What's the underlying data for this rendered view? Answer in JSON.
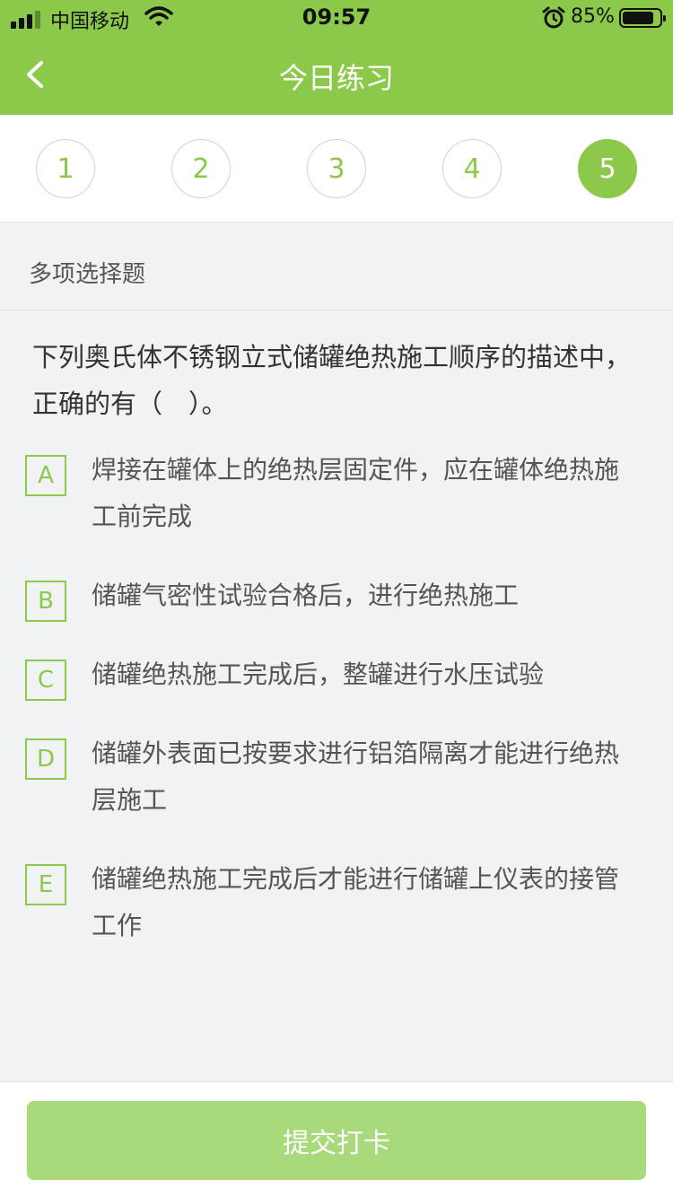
{
  "status_bar": {
    "carrier": "中国移动",
    "time": "09:57",
    "battery_pct": "85%",
    "battery_level": 0.85,
    "icons": [
      "signal-icon",
      "wifi-icon",
      "alarm-icon",
      "battery-icon"
    ]
  },
  "nav": {
    "title": "今日练习",
    "back_icon": "chevron-left-icon"
  },
  "tabs": {
    "items": [
      "1",
      "2",
      "3",
      "4",
      "5"
    ],
    "active_index": 4
  },
  "question": {
    "type": "多项选择题",
    "stem": "下列奥氏体不锈钢立式储罐绝热施工顺序的描述中，正确的有（　）。",
    "options": [
      {
        "letter": "A",
        "text": "焊接在罐体上的绝热层固定件，应在罐体绝热施工前完成"
      },
      {
        "letter": "B",
        "text": "储罐气密性试验合格后，进行绝热施工"
      },
      {
        "letter": "C",
        "text": "储罐绝热施工完成后，整罐进行水压试验"
      },
      {
        "letter": "D",
        "text": "储罐外表面已按要求进行铝箔隔离才能进行绝热层施工"
      },
      {
        "letter": "E",
        "text": "储罐绝热施工完成后才能进行储罐上仪表的接管工作"
      }
    ]
  },
  "footer": {
    "submit_label": "提交打卡"
  },
  "colors": {
    "accent": "#8cc94a",
    "submit_disabled": "#a8d97a",
    "background": "#f1f2f4"
  }
}
